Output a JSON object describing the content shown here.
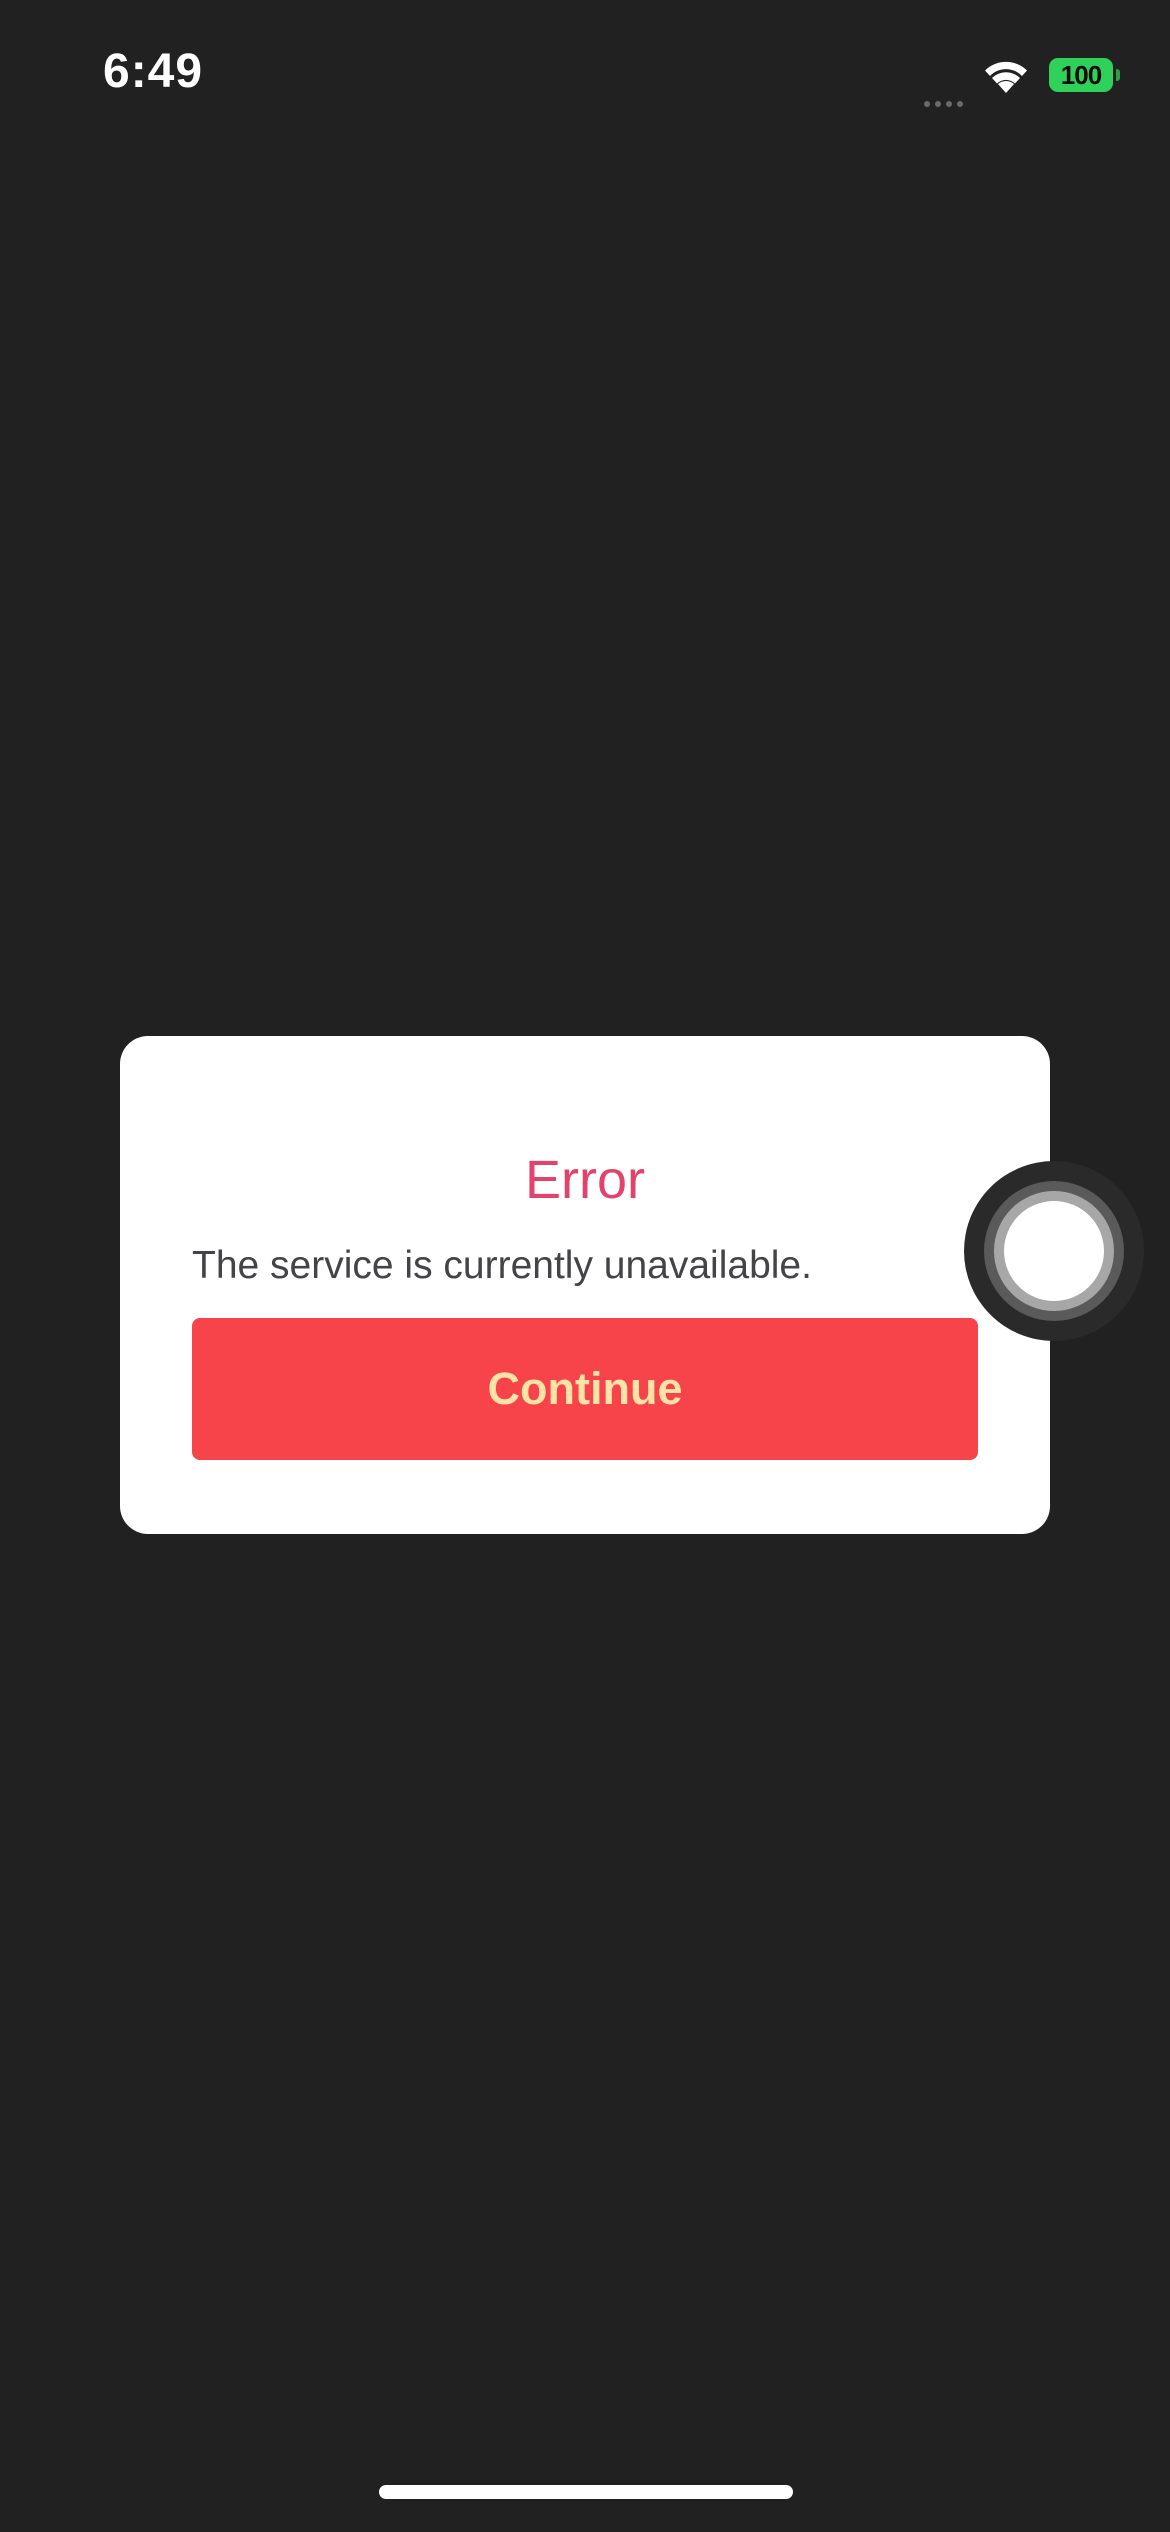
{
  "status_bar": {
    "time": "6:49",
    "battery_level": "100",
    "icons": [
      "signal-icon",
      "wifi-icon",
      "battery-icon"
    ]
  },
  "dialog": {
    "title": "Error",
    "message": "The service is currently unavailable.",
    "button_label": "Continue"
  },
  "colors": {
    "background": "#212121",
    "dialog_background": "#ffffff",
    "title": "#e2436c",
    "button": "#f7434a",
    "button_text": "#ffe2a6",
    "battery": "#30d158"
  }
}
